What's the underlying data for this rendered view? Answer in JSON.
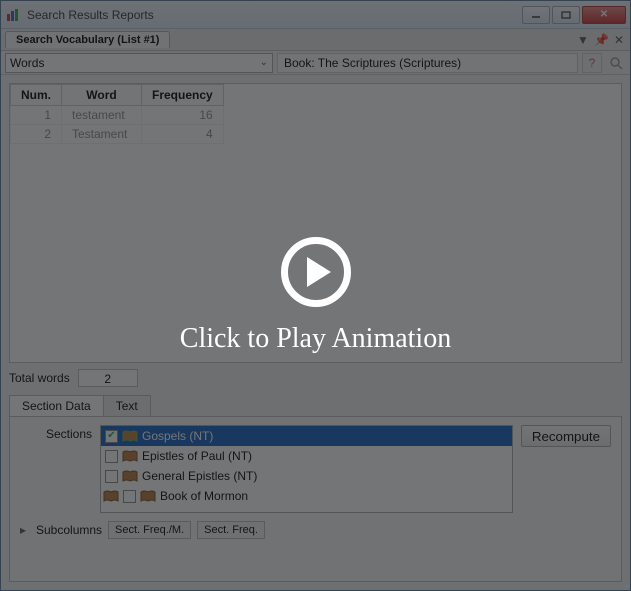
{
  "window": {
    "title": "Search Results Reports"
  },
  "tabstrip": {
    "tab_label": "Search Vocabulary (List #1)"
  },
  "toolbar": {
    "mode_label": "Words",
    "book_label": "Book: The Scriptures (Scriptures)"
  },
  "table": {
    "headers": {
      "num": "Num.",
      "word": "Word",
      "freq": "Frequency"
    },
    "rows": [
      {
        "num": "1",
        "word": "testament",
        "freq": "16"
      },
      {
        "num": "2",
        "word": "Testament",
        "freq": "4"
      }
    ]
  },
  "totals": {
    "label": "Total words",
    "value": "2"
  },
  "lower": {
    "tabs": {
      "section_data": "Section Data",
      "text": "Text"
    },
    "sections_label": "Sections",
    "recompute_label": "Recompute",
    "items": [
      {
        "label": "Gospels (NT)",
        "checked": true,
        "selected": true
      },
      {
        "label": "Epistles of Paul (NT)",
        "checked": false,
        "selected": false
      },
      {
        "label": "General Epistles (NT)",
        "checked": false,
        "selected": false
      },
      {
        "label": "Book of Mormon",
        "checked": false,
        "selected": false
      }
    ],
    "subcolumns_label": "Subcolumns",
    "chips": {
      "a": "Sect. Freq./M.",
      "b": "Sect. Freq."
    }
  },
  "overlay": {
    "text": "Click to Play Animation"
  }
}
